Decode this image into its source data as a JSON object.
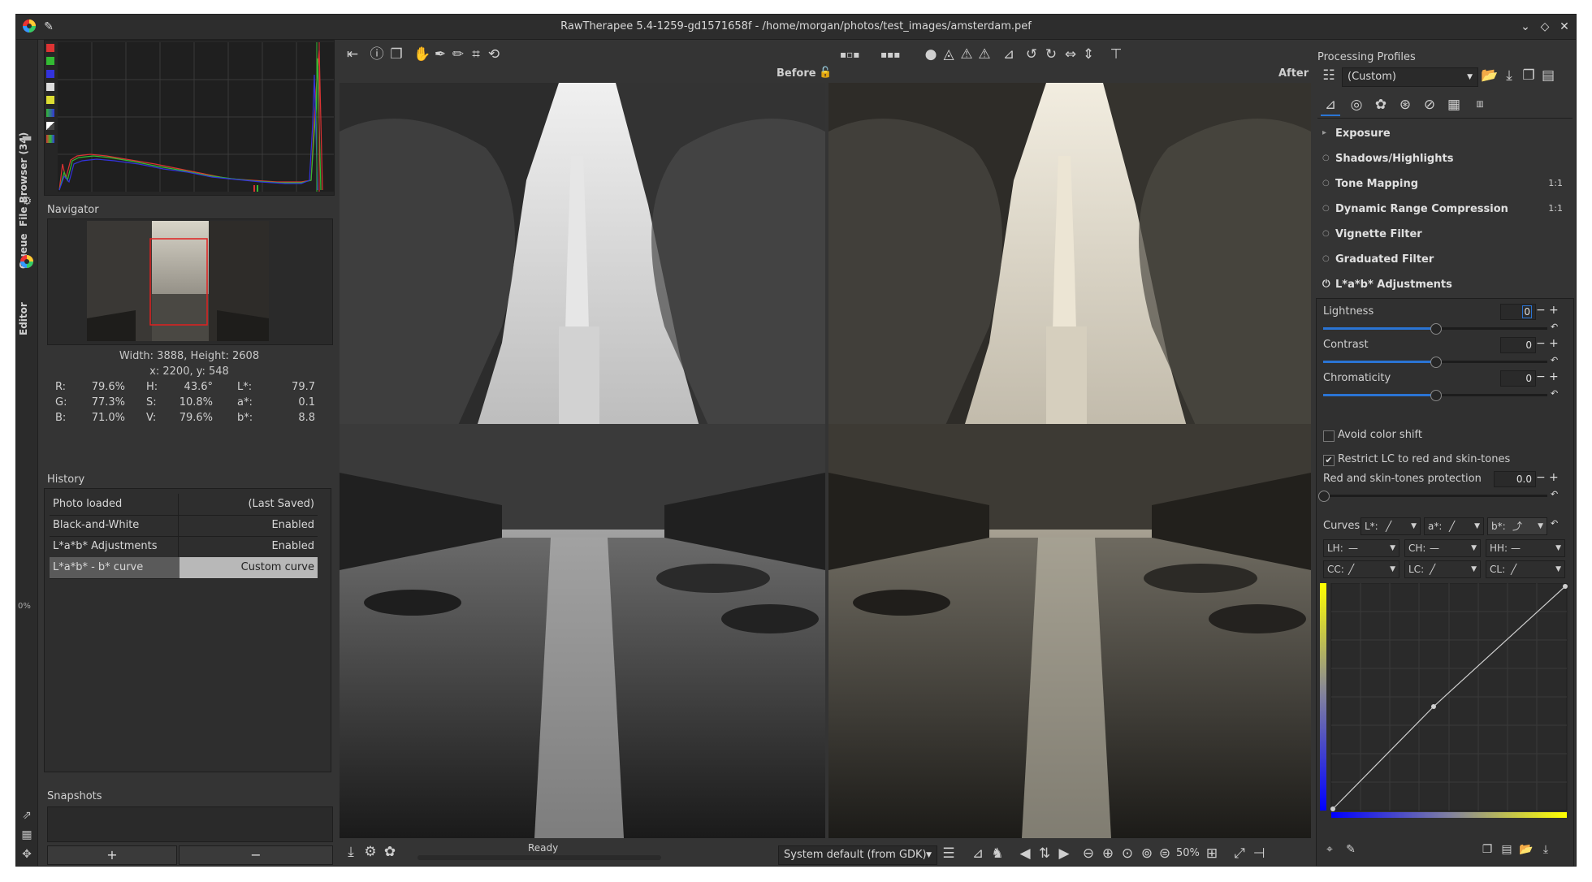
{
  "window": {
    "title": "RawTherapee 5.4-1259-gd1571658f - /home/morgan/photos/test_images/amsterdam.pef"
  },
  "vertical_tabs": {
    "file_browser": "File Browser (34)",
    "queue": "Queue",
    "editor": "Editor",
    "percent": "0%"
  },
  "navigator": {
    "title": "Navigator",
    "size_text": "Width: 3888, Height: 2608",
    "coords_text": "x: 2200, y: 548",
    "values": [
      {
        "k1": "R:",
        "v1": "79.6%",
        "k2": "H:",
        "v2": "43.6°",
        "k3": "L*:",
        "v3": "79.7"
      },
      {
        "k1": "G:",
        "v1": "77.3%",
        "k2": "S:",
        "v2": "10.8%",
        "k3": "a*:",
        "v3": "0.1"
      },
      {
        "k1": "B:",
        "v1": "71.0%",
        "k2": "V:",
        "v2": "79.6%",
        "k3": "b*:",
        "v3": "8.8"
      }
    ]
  },
  "history": {
    "title": "History",
    "rows": [
      {
        "label": "Photo loaded",
        "value": "(Last Saved)"
      },
      {
        "label": "Black-and-White",
        "value": "Enabled"
      },
      {
        "label": "L*a*b* Adjustments",
        "value": "Enabled"
      },
      {
        "label": "L*a*b* - b* curve",
        "value": "Custom curve"
      }
    ]
  },
  "snapshots": {
    "title": "Snapshots",
    "add": "+",
    "remove": "−"
  },
  "preview": {
    "before_label": "Before",
    "after_label": "After"
  },
  "statusbar": {
    "status": "Ready",
    "profile": "System default (from GDK)",
    "zoom": "50%"
  },
  "processing_profiles": {
    "title": "Processing Profiles",
    "selected": "(Custom)"
  },
  "tools": [
    {
      "label": "Exposure",
      "marker": "▸",
      "oneone": ""
    },
    {
      "label": "Shadows/Highlights",
      "marker": "○",
      "oneone": ""
    },
    {
      "label": "Tone Mapping",
      "marker": "○",
      "oneone": "1:1"
    },
    {
      "label": "Dynamic Range Compression",
      "marker": "○",
      "oneone": "1:1"
    },
    {
      "label": "Vignette Filter",
      "marker": "○",
      "oneone": ""
    },
    {
      "label": "Graduated Filter",
      "marker": "○",
      "oneone": ""
    },
    {
      "label": "L*a*b* Adjustments",
      "marker": "⏻",
      "oneone": ""
    }
  ],
  "lab": {
    "lightness": {
      "label": "Lightness",
      "value": "0",
      "level": 0.5
    },
    "contrast": {
      "label": "Contrast",
      "value": "0",
      "level": 0.5
    },
    "chromaticity": {
      "label": "Chromaticity",
      "value": "0",
      "level": 0.5
    },
    "avoid_color_shift": {
      "label": "Avoid color shift",
      "checked": false
    },
    "restrict_lc": {
      "label": "Restrict LC to red and skin-tones",
      "checked": true
    },
    "rstprotection": {
      "label": "Red and skin-tones protection",
      "value": "0.0",
      "level": 0.0
    },
    "curves_label": "Curves:",
    "curve_buttons": [
      {
        "label": "L*:",
        "shape": "linear"
      },
      {
        "label": "a*:",
        "shape": "linear"
      },
      {
        "label": "b*:",
        "shape": "custom"
      },
      {
        "label": "LH:",
        "shape": "flat"
      },
      {
        "label": "CH:",
        "shape": "flat"
      },
      {
        "label": "HH:",
        "shape": "flat"
      },
      {
        "label": "CC:",
        "shape": "linear"
      },
      {
        "label": "LC:",
        "shape": "linear"
      },
      {
        "label": "CL:",
        "shape": "linear"
      }
    ]
  }
}
